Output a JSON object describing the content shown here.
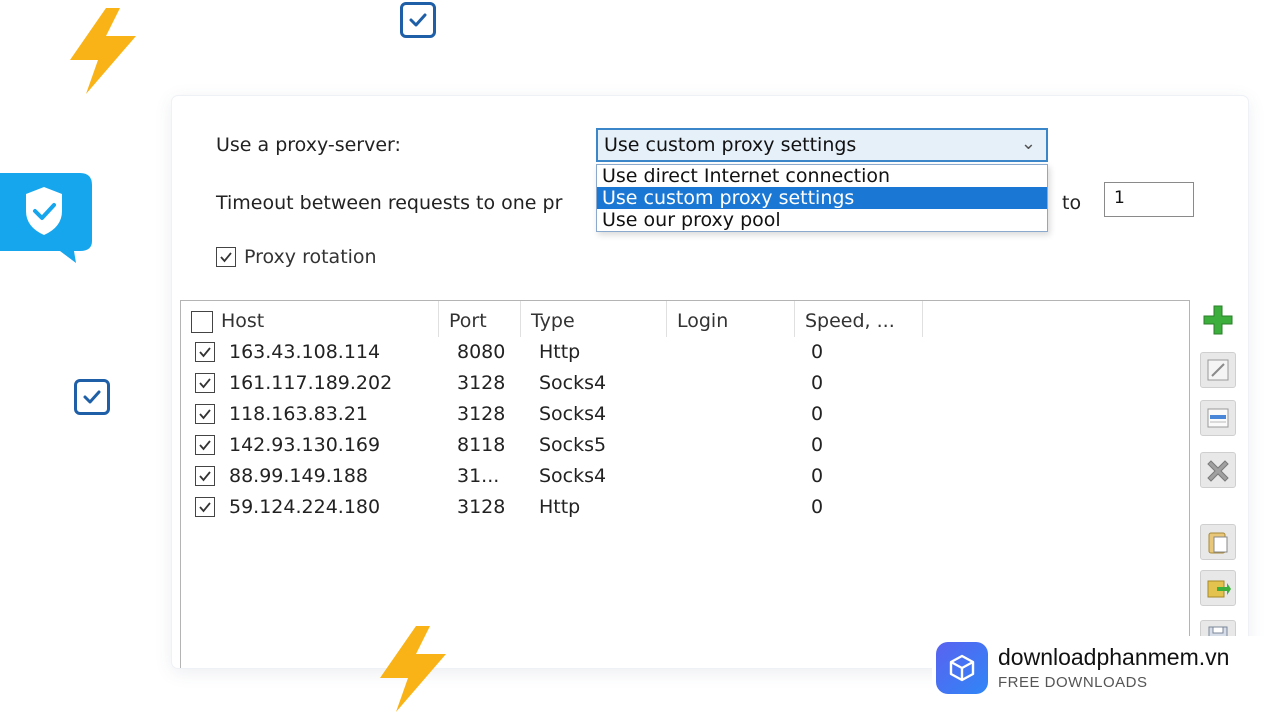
{
  "proxy": {
    "label": "Use a proxy-server:",
    "selected": "Use custom proxy settings",
    "options": [
      "Use direct Internet connection",
      "Use custom proxy settings",
      "Use our proxy pool"
    ],
    "selected_index": 1
  },
  "timeout": {
    "label": "Timeout between requests to one pr",
    "to_label": "to",
    "to_value": "1"
  },
  "rotation": {
    "label": "Proxy rotation",
    "checked": true
  },
  "table": {
    "columns": [
      "Host",
      "Port",
      "Type",
      "Login",
      "Speed, ..."
    ],
    "rows": [
      {
        "host": "163.43.108.114",
        "port": "8080",
        "type": "Http",
        "login": "",
        "speed": "0"
      },
      {
        "host": "161.117.189.202",
        "port": "3128",
        "type": "Socks4",
        "login": "",
        "speed": "0"
      },
      {
        "host": "118.163.83.21",
        "port": "3128",
        "type": "Socks4",
        "login": "",
        "speed": "0"
      },
      {
        "host": "142.93.130.169",
        "port": "8118",
        "type": "Socks5",
        "login": "",
        "speed": "0"
      },
      {
        "host": "88.99.149.188",
        "port": "31...",
        "type": "Socks4",
        "login": "",
        "speed": "0"
      },
      {
        "host": "59.124.224.180",
        "port": "3128",
        "type": "Http",
        "login": "",
        "speed": "0"
      }
    ]
  },
  "toolbar": {
    "buttons": [
      "add-icon",
      "edit-icon",
      "list-icon",
      "delete-icon",
      "paste-icon",
      "import-icon",
      "save-icon"
    ]
  },
  "watermark": {
    "name": "downloadphanmem.vn",
    "tagline": "FREE DOWNLOADS"
  },
  "colors": {
    "accent": "#1a78d4",
    "bolt": "#f9b316",
    "shield_bubble": "#15a6ee",
    "checkbox_badge": "#1e5fa8",
    "add_green": "#3cae3c"
  }
}
